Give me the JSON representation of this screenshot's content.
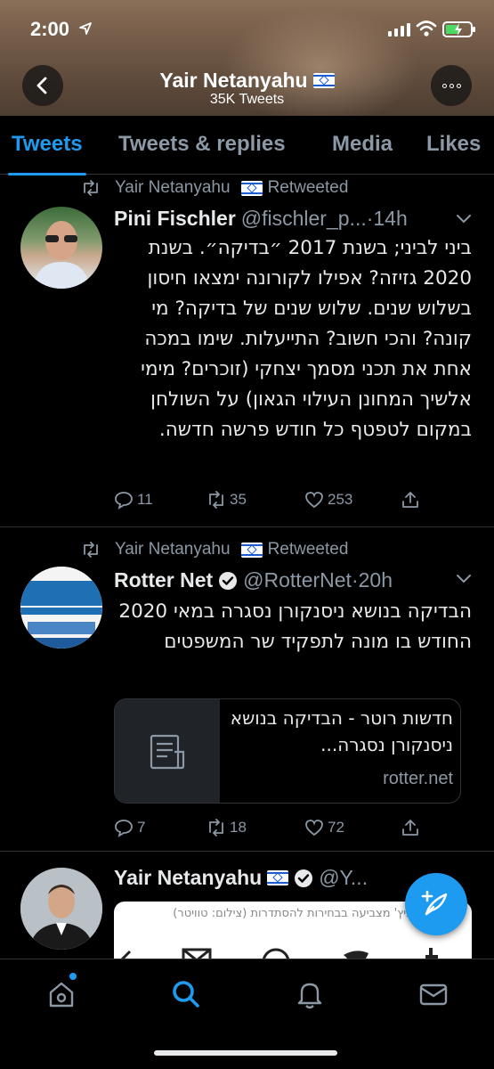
{
  "status_bar": {
    "time": "2:00"
  },
  "header": {
    "title": "Yair Netanyahu",
    "subtitle": "35K Tweets"
  },
  "tabs": [
    {
      "label": "Tweets",
      "active": true
    },
    {
      "label": "Tweets & replies",
      "active": false
    },
    {
      "label": "Media",
      "active": false
    },
    {
      "label": "Likes",
      "active": false
    }
  ],
  "tweets": [
    {
      "retweeted_by": "Yair Netanyahu",
      "retweeted_label": "Retweeted",
      "author_name": "Pini Fischler",
      "handle": "@fischler_p...",
      "time": "·14h",
      "text": "ביני לביני; בשנת 2017 ״בדיקה״. בשנת 2020 גזיזה? אפילו לקורונה ימצאו חיסון בשלוש שנים. שלוש שנים של בדיקה? מי קונה? והכי חשוב? התייעלות. שימו במכה אחת את תכני מסמך יצחקי (זוכרים? מימי אלשיך המחונן העילוי הגאון) על השולחן במקום לטפטף כל חודש פרשה חדשה.",
      "replies": "11",
      "retweets": "35",
      "likes": "253"
    },
    {
      "retweeted_by": "Yair Netanyahu",
      "retweeted_label": "Retweeted",
      "author_name": "Rotter Net",
      "handle": "@RotterNet",
      "time": "·20h",
      "text": "הבדיקה בנושא ניסנקורן נסגרה במאי 2020 החודש בו מונה לתפקיד שר המשפטים",
      "card_title": "חדשות רוטר - הבדיקה בנושא ניסנקורן נסגרה...",
      "card_domain": "rotter.net",
      "replies": "7",
      "retweets": "18",
      "likes": "72"
    },
    {
      "author_name": "Yair Netanyahu",
      "handle": "@Y...",
      "embed_caption": "ביץ' מצביעה בבחירות להסתדרות (צילום: טוויטר)"
    }
  ],
  "colors": {
    "accent": "#1d9bf0",
    "muted": "#8b98a5",
    "background": "#000000"
  }
}
